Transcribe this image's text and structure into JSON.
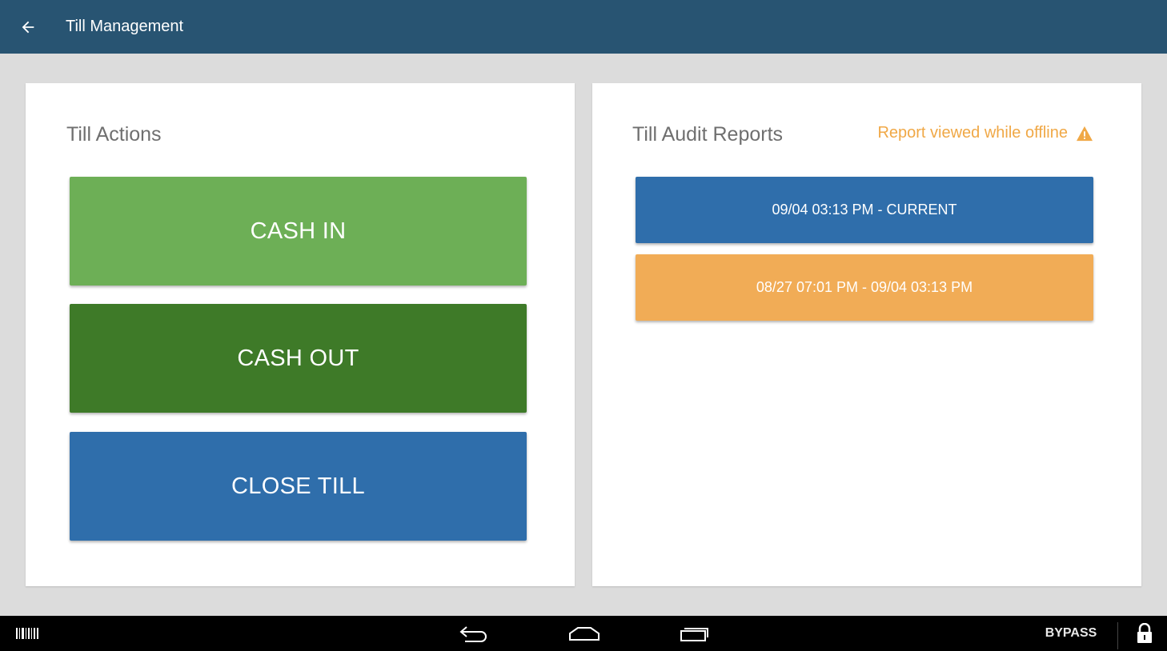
{
  "header": {
    "title": "Till Management"
  },
  "till_actions": {
    "title": "Till Actions",
    "buttons": [
      "CASH IN",
      "CASH OUT",
      "CLOSE TILL"
    ]
  },
  "till_audit": {
    "title": "Till Audit Reports",
    "offline_warning": "Report viewed while offline",
    "reports": [
      "09/04 03:13 PM - CURRENT",
      "08/27 07:01 PM - 09/04 03:13 PM"
    ]
  },
  "navbar": {
    "bypass_label": "BYPASS"
  },
  "colors": {
    "appbar": "#285472",
    "cash_in": "#6daf56",
    "cash_out": "#3e7a28",
    "close_till": "#2f6eab",
    "report_current": "#2f6eab",
    "report_past": "#f1ac56",
    "warning": "#f0a846"
  },
  "icons": {
    "back": "arrow-left-icon",
    "warning": "warning-triangle-icon",
    "barcode": "barcode-icon",
    "nav_back": "nav-back-icon",
    "nav_home": "nav-home-icon",
    "nav_recents": "nav-recents-icon",
    "lock": "lock-icon"
  }
}
